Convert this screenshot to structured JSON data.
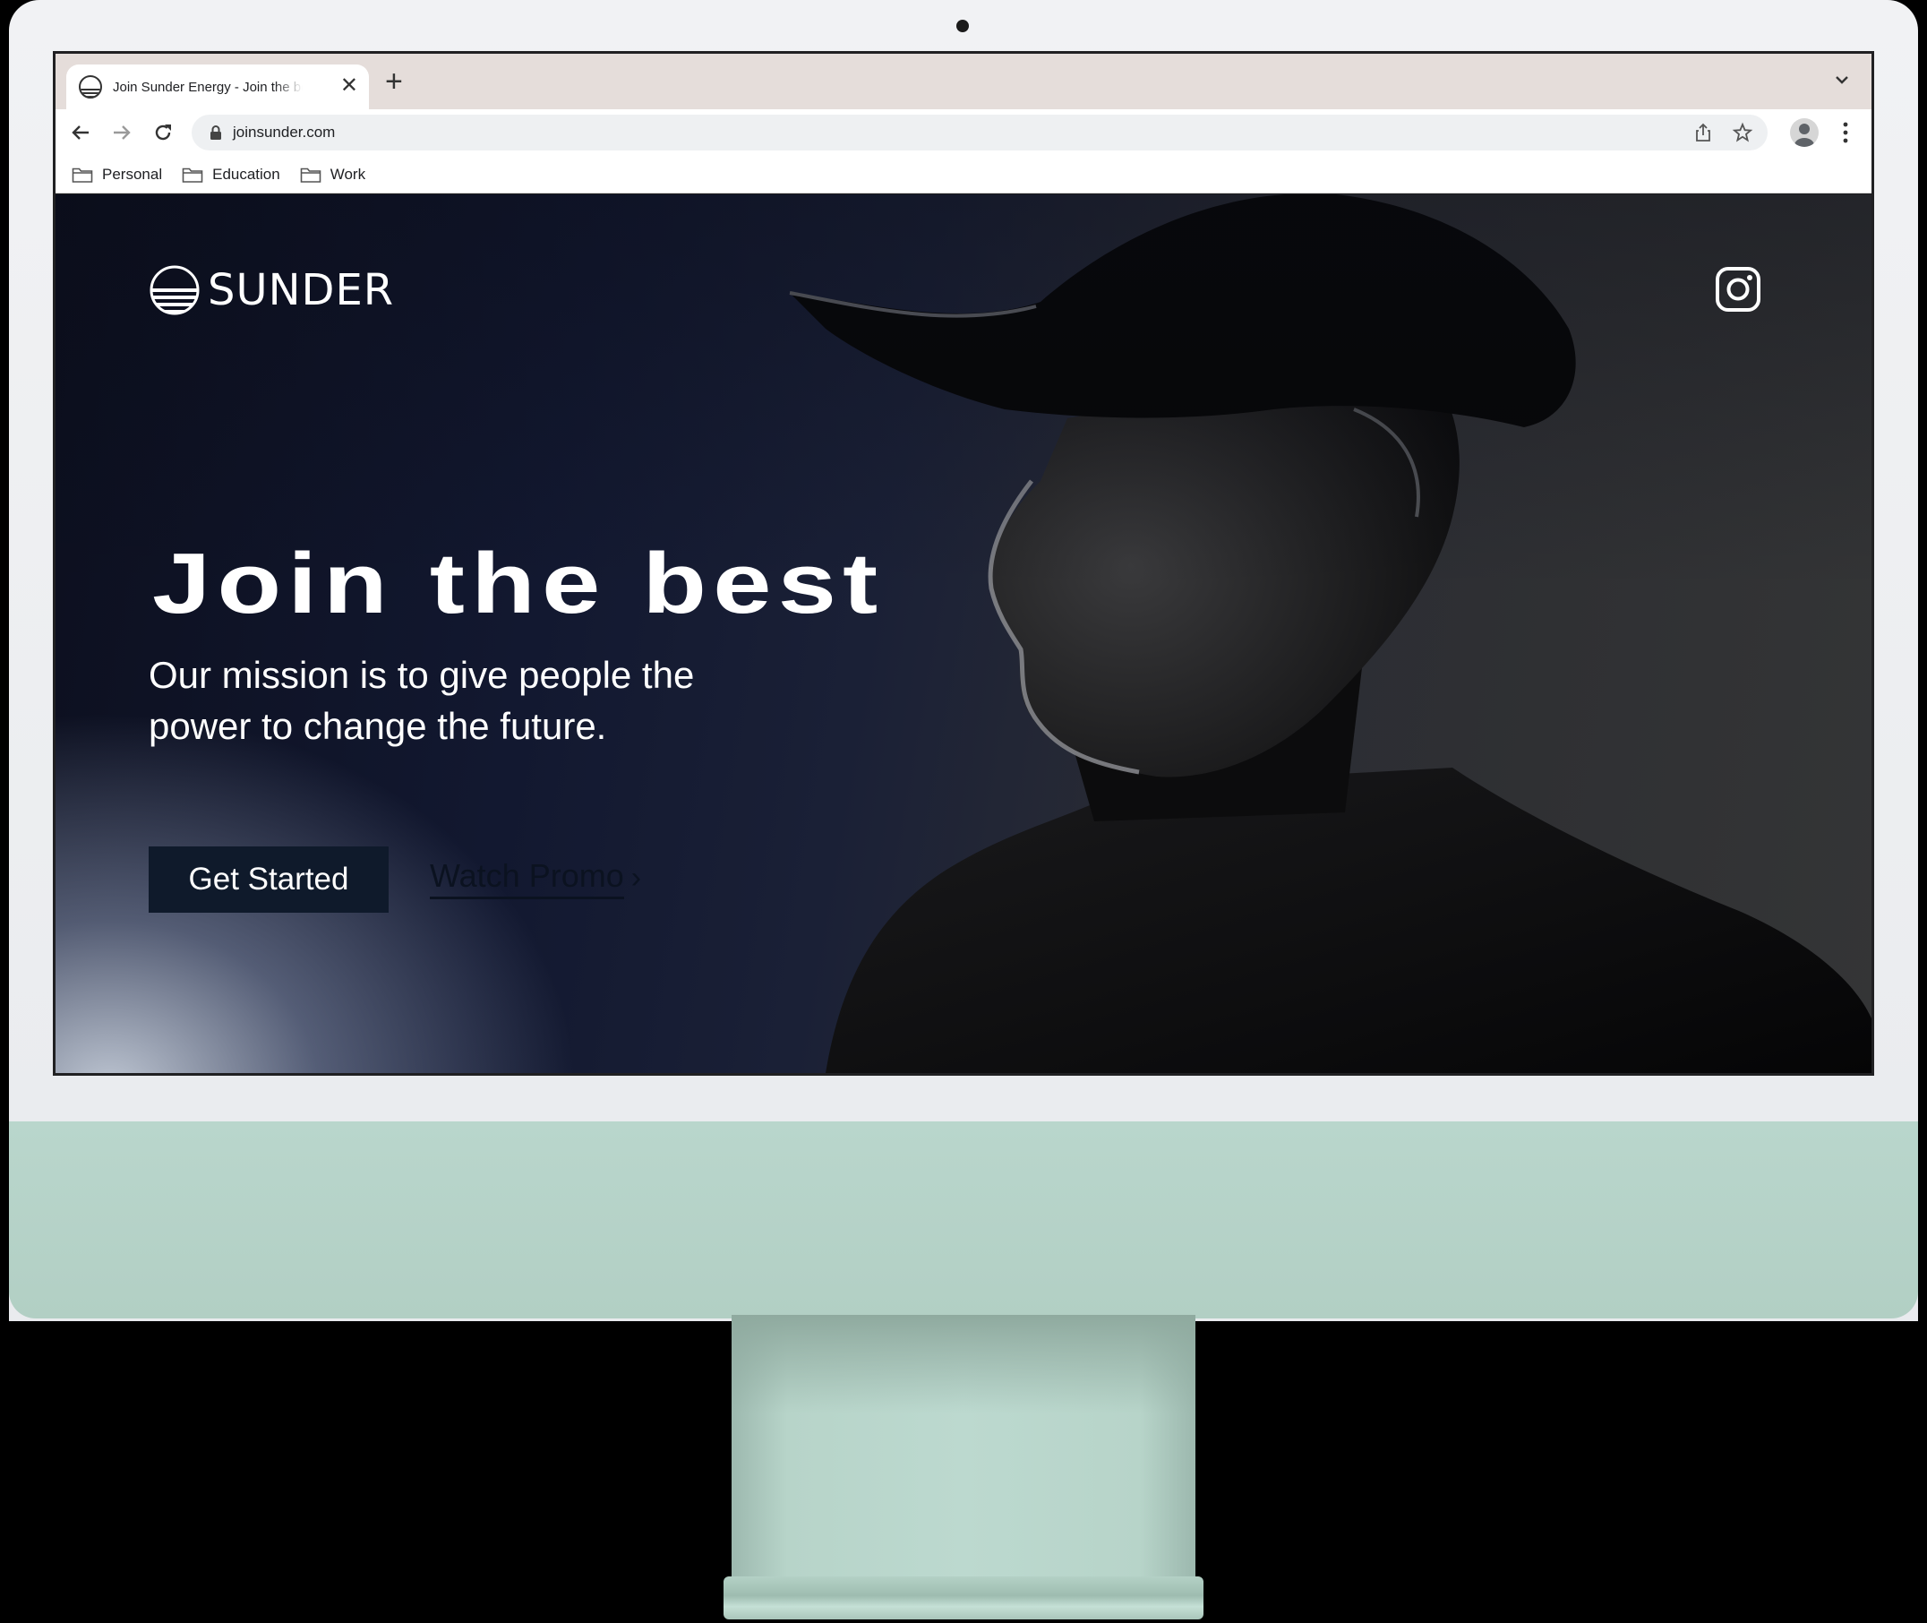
{
  "browser": {
    "tab_title": "Join Sunder Energy - Join the best",
    "new_tab_label": "+",
    "close_label": "✕",
    "url": "joinsunder.com",
    "bookmarks": [
      {
        "label": "Personal"
      },
      {
        "label": "Education"
      },
      {
        "label": "Work"
      }
    ]
  },
  "site": {
    "logo_text": "SUNDER",
    "hero_title": "Join the best",
    "hero_subtitle": "Our mission is to give people the power to change the future.",
    "cta_primary": "Get Started",
    "cta_secondary": "Watch Promo",
    "cta_secondary_chevron": "›"
  },
  "colors": {
    "device_chin": "#b5d2c7",
    "tabstrip": "#e5ddda",
    "button_primary": "#0f1a2b"
  }
}
